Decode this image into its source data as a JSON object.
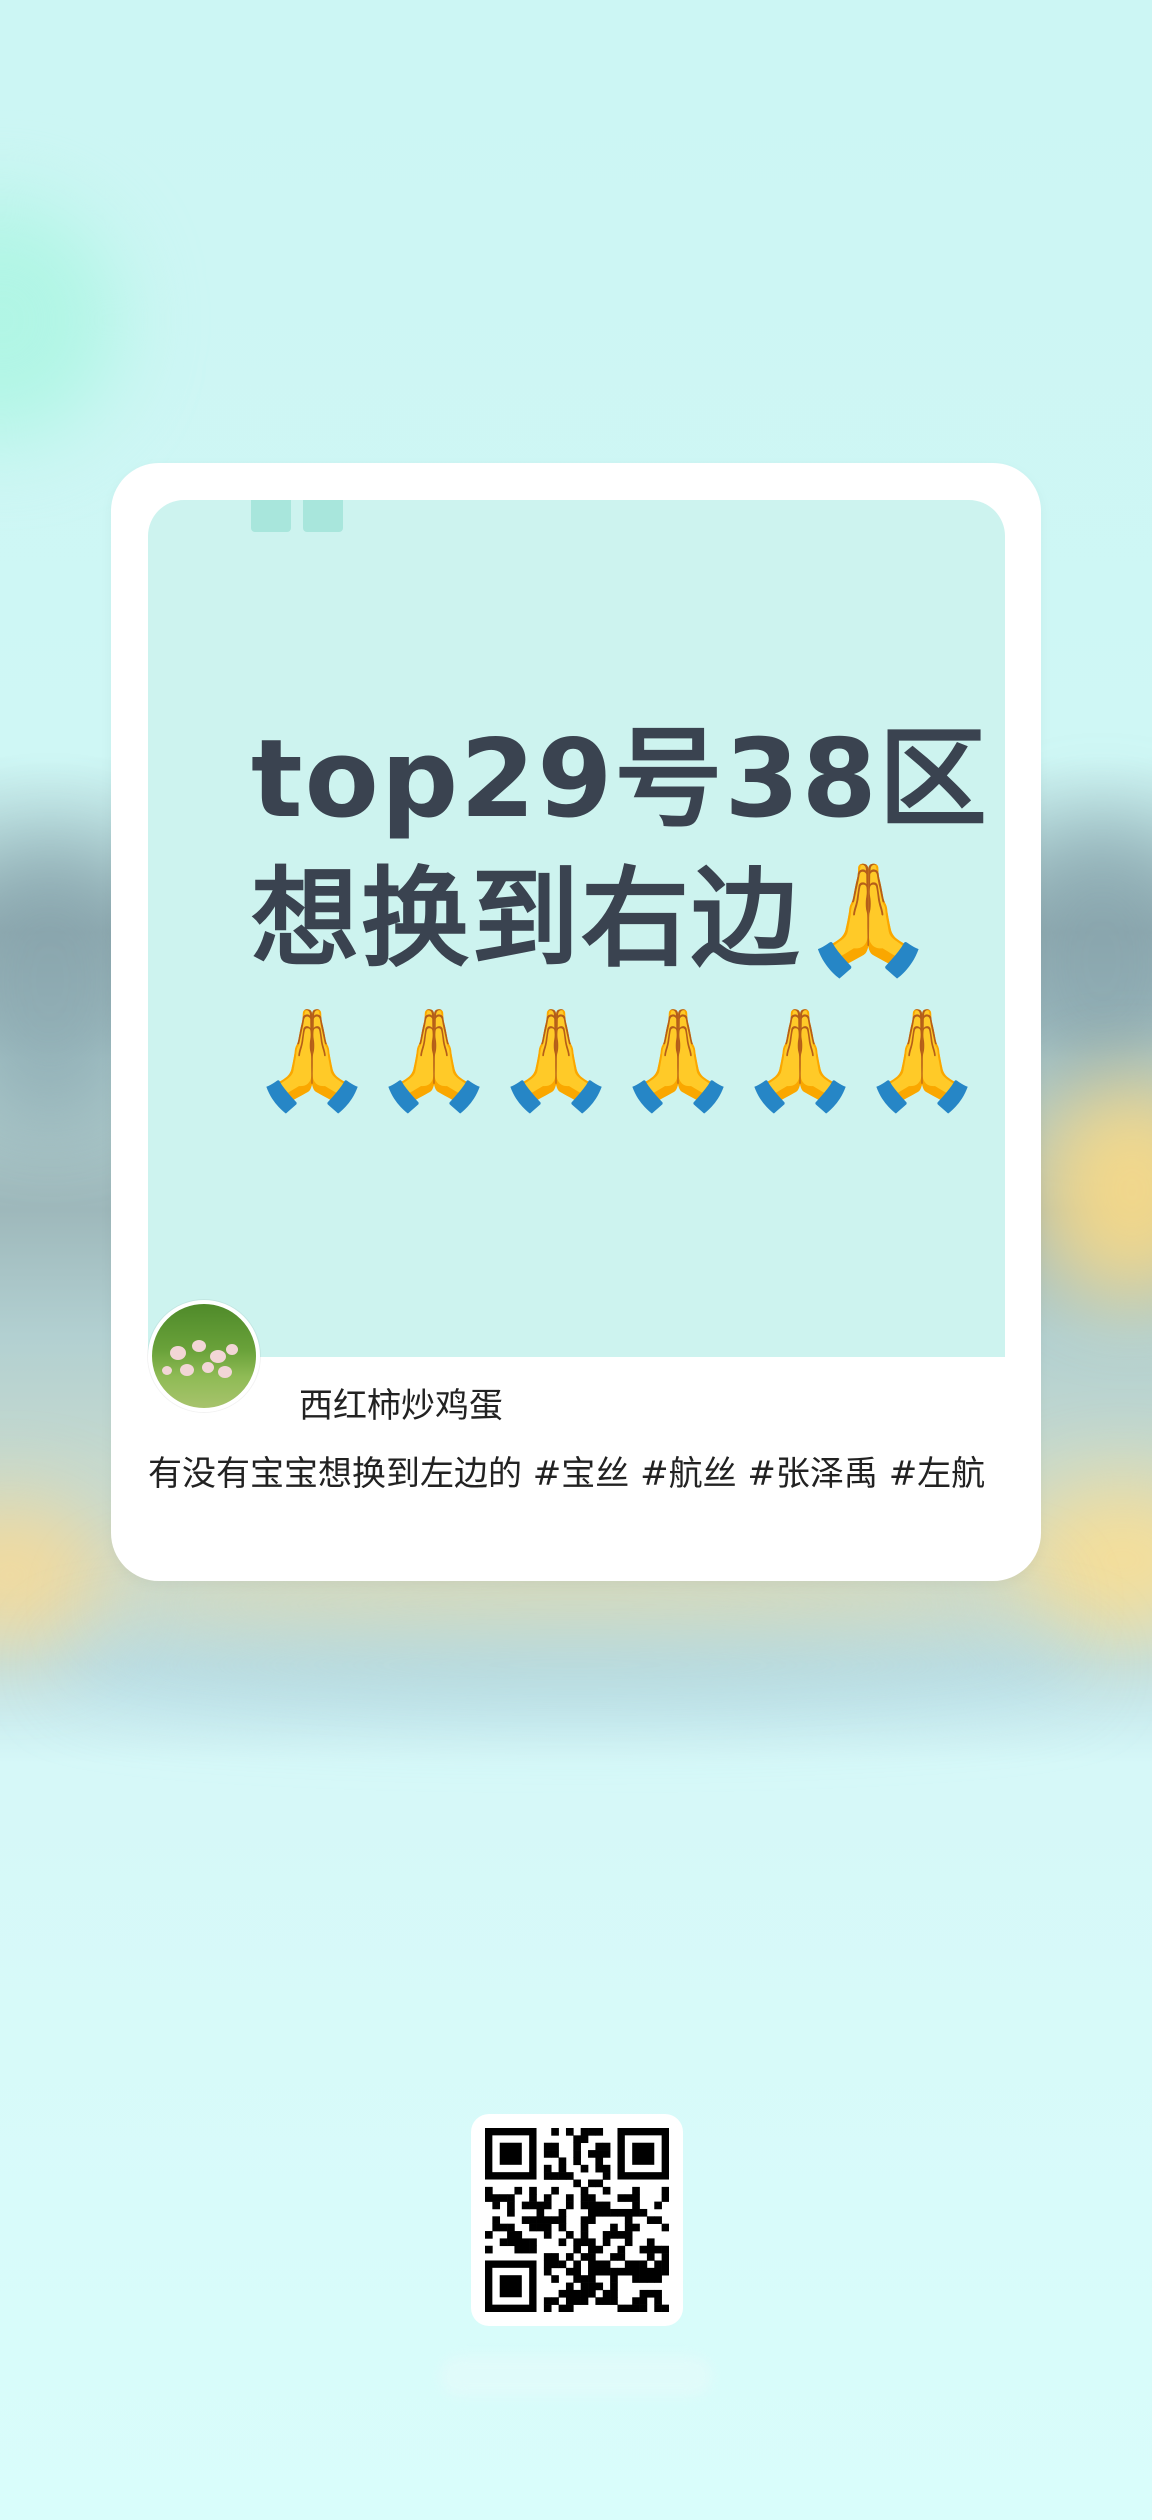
{
  "card": {
    "cover_lines": [
      "top29号38区",
      "想换到右边🙏",
      "🙏🙏🙏🙏🙏🙏"
    ],
    "author_name": "西红柿炒鸡蛋",
    "caption": "有没有宝宝想换到左边的 #宝丝 #航丝 #张泽禹 #左航"
  },
  "colors": {
    "background": "#d9fdfb",
    "cover_bg": "#cdf3ef",
    "cover_text": "#3a4350",
    "card_bg": "#ffffff"
  },
  "icons": {
    "quote": "quote-mark-icon",
    "avatar": "avatar-image",
    "qr": "qr-code"
  }
}
